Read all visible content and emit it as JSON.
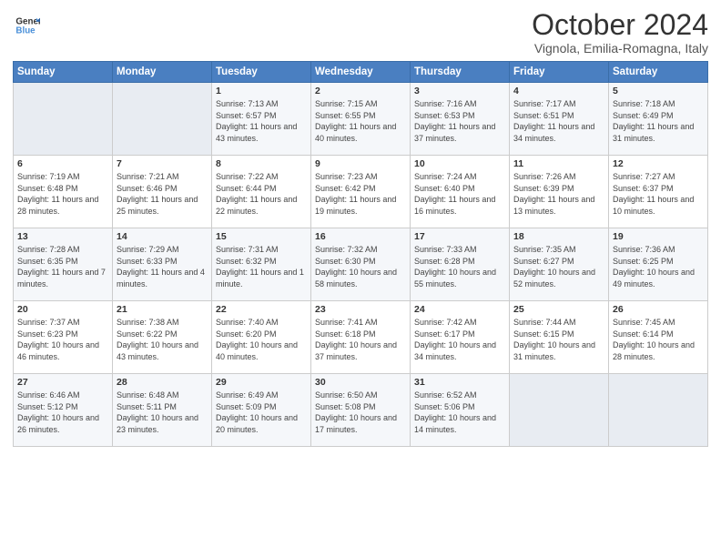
{
  "header": {
    "logo_line1": "General",
    "logo_line2": "Blue",
    "month": "October 2024",
    "location": "Vignola, Emilia-Romagna, Italy"
  },
  "days_of_week": [
    "Sunday",
    "Monday",
    "Tuesday",
    "Wednesday",
    "Thursday",
    "Friday",
    "Saturday"
  ],
  "rows": [
    [
      {
        "day": "",
        "sunrise": "",
        "sunset": "",
        "daylight": ""
      },
      {
        "day": "",
        "sunrise": "",
        "sunset": "",
        "daylight": ""
      },
      {
        "day": "1",
        "sunrise": "Sunrise: 7:13 AM",
        "sunset": "Sunset: 6:57 PM",
        "daylight": "Daylight: 11 hours and 43 minutes."
      },
      {
        "day": "2",
        "sunrise": "Sunrise: 7:15 AM",
        "sunset": "Sunset: 6:55 PM",
        "daylight": "Daylight: 11 hours and 40 minutes."
      },
      {
        "day": "3",
        "sunrise": "Sunrise: 7:16 AM",
        "sunset": "Sunset: 6:53 PM",
        "daylight": "Daylight: 11 hours and 37 minutes."
      },
      {
        "day": "4",
        "sunrise": "Sunrise: 7:17 AM",
        "sunset": "Sunset: 6:51 PM",
        "daylight": "Daylight: 11 hours and 34 minutes."
      },
      {
        "day": "5",
        "sunrise": "Sunrise: 7:18 AM",
        "sunset": "Sunset: 6:49 PM",
        "daylight": "Daylight: 11 hours and 31 minutes."
      }
    ],
    [
      {
        "day": "6",
        "sunrise": "Sunrise: 7:19 AM",
        "sunset": "Sunset: 6:48 PM",
        "daylight": "Daylight: 11 hours and 28 minutes."
      },
      {
        "day": "7",
        "sunrise": "Sunrise: 7:21 AM",
        "sunset": "Sunset: 6:46 PM",
        "daylight": "Daylight: 11 hours and 25 minutes."
      },
      {
        "day": "8",
        "sunrise": "Sunrise: 7:22 AM",
        "sunset": "Sunset: 6:44 PM",
        "daylight": "Daylight: 11 hours and 22 minutes."
      },
      {
        "day": "9",
        "sunrise": "Sunrise: 7:23 AM",
        "sunset": "Sunset: 6:42 PM",
        "daylight": "Daylight: 11 hours and 19 minutes."
      },
      {
        "day": "10",
        "sunrise": "Sunrise: 7:24 AM",
        "sunset": "Sunset: 6:40 PM",
        "daylight": "Daylight: 11 hours and 16 minutes."
      },
      {
        "day": "11",
        "sunrise": "Sunrise: 7:26 AM",
        "sunset": "Sunset: 6:39 PM",
        "daylight": "Daylight: 11 hours and 13 minutes."
      },
      {
        "day": "12",
        "sunrise": "Sunrise: 7:27 AM",
        "sunset": "Sunset: 6:37 PM",
        "daylight": "Daylight: 11 hours and 10 minutes."
      }
    ],
    [
      {
        "day": "13",
        "sunrise": "Sunrise: 7:28 AM",
        "sunset": "Sunset: 6:35 PM",
        "daylight": "Daylight: 11 hours and 7 minutes."
      },
      {
        "day": "14",
        "sunrise": "Sunrise: 7:29 AM",
        "sunset": "Sunset: 6:33 PM",
        "daylight": "Daylight: 11 hours and 4 minutes."
      },
      {
        "day": "15",
        "sunrise": "Sunrise: 7:31 AM",
        "sunset": "Sunset: 6:32 PM",
        "daylight": "Daylight: 11 hours and 1 minute."
      },
      {
        "day": "16",
        "sunrise": "Sunrise: 7:32 AM",
        "sunset": "Sunset: 6:30 PM",
        "daylight": "Daylight: 10 hours and 58 minutes."
      },
      {
        "day": "17",
        "sunrise": "Sunrise: 7:33 AM",
        "sunset": "Sunset: 6:28 PM",
        "daylight": "Daylight: 10 hours and 55 minutes."
      },
      {
        "day": "18",
        "sunrise": "Sunrise: 7:35 AM",
        "sunset": "Sunset: 6:27 PM",
        "daylight": "Daylight: 10 hours and 52 minutes."
      },
      {
        "day": "19",
        "sunrise": "Sunrise: 7:36 AM",
        "sunset": "Sunset: 6:25 PM",
        "daylight": "Daylight: 10 hours and 49 minutes."
      }
    ],
    [
      {
        "day": "20",
        "sunrise": "Sunrise: 7:37 AM",
        "sunset": "Sunset: 6:23 PM",
        "daylight": "Daylight: 10 hours and 46 minutes."
      },
      {
        "day": "21",
        "sunrise": "Sunrise: 7:38 AM",
        "sunset": "Sunset: 6:22 PM",
        "daylight": "Daylight: 10 hours and 43 minutes."
      },
      {
        "day": "22",
        "sunrise": "Sunrise: 7:40 AM",
        "sunset": "Sunset: 6:20 PM",
        "daylight": "Daylight: 10 hours and 40 minutes."
      },
      {
        "day": "23",
        "sunrise": "Sunrise: 7:41 AM",
        "sunset": "Sunset: 6:18 PM",
        "daylight": "Daylight: 10 hours and 37 minutes."
      },
      {
        "day": "24",
        "sunrise": "Sunrise: 7:42 AM",
        "sunset": "Sunset: 6:17 PM",
        "daylight": "Daylight: 10 hours and 34 minutes."
      },
      {
        "day": "25",
        "sunrise": "Sunrise: 7:44 AM",
        "sunset": "Sunset: 6:15 PM",
        "daylight": "Daylight: 10 hours and 31 minutes."
      },
      {
        "day": "26",
        "sunrise": "Sunrise: 7:45 AM",
        "sunset": "Sunset: 6:14 PM",
        "daylight": "Daylight: 10 hours and 28 minutes."
      }
    ],
    [
      {
        "day": "27",
        "sunrise": "Sunrise: 6:46 AM",
        "sunset": "Sunset: 5:12 PM",
        "daylight": "Daylight: 10 hours and 26 minutes."
      },
      {
        "day": "28",
        "sunrise": "Sunrise: 6:48 AM",
        "sunset": "Sunset: 5:11 PM",
        "daylight": "Daylight: 10 hours and 23 minutes."
      },
      {
        "day": "29",
        "sunrise": "Sunrise: 6:49 AM",
        "sunset": "Sunset: 5:09 PM",
        "daylight": "Daylight: 10 hours and 20 minutes."
      },
      {
        "day": "30",
        "sunrise": "Sunrise: 6:50 AM",
        "sunset": "Sunset: 5:08 PM",
        "daylight": "Daylight: 10 hours and 17 minutes."
      },
      {
        "day": "31",
        "sunrise": "Sunrise: 6:52 AM",
        "sunset": "Sunset: 5:06 PM",
        "daylight": "Daylight: 10 hours and 14 minutes."
      },
      {
        "day": "",
        "sunrise": "",
        "sunset": "",
        "daylight": ""
      },
      {
        "day": "",
        "sunrise": "",
        "sunset": "",
        "daylight": ""
      }
    ]
  ]
}
